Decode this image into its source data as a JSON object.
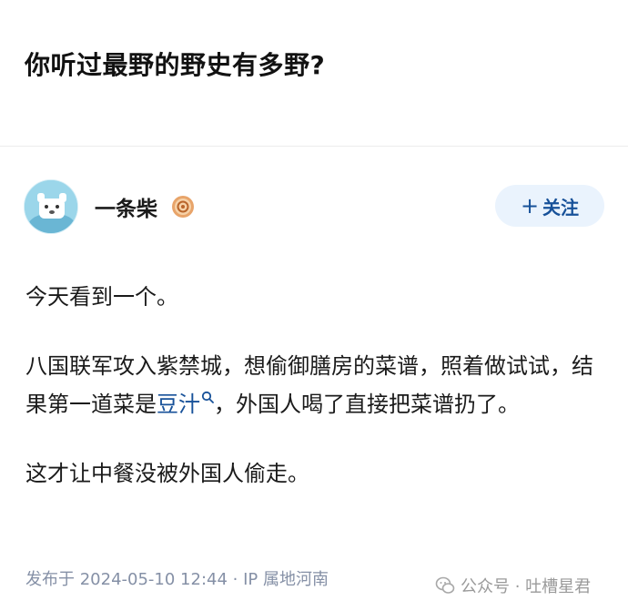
{
  "question": {
    "title": "你听过最野的野史有多野?"
  },
  "author": {
    "name": "一条柴",
    "follow_label": "关注",
    "follow_plus": "+"
  },
  "answer": {
    "para1": "今天看到一个。",
    "para2_before": "八国联军攻入紫禁城，想偷御膳房的菜谱，照着做试试，结果第一道菜是",
    "para2_link": "豆汁",
    "para2_after": "，外国人喝了直接把菜谱扔了。",
    "para3": "这才让中餐没被外国人偷走。"
  },
  "meta": {
    "published": "发布于 2024-05-10 12:44 · IP 属地河南"
  },
  "watermark": {
    "text": "公众号 · 吐槽星君"
  },
  "colors": {
    "link": "#175199",
    "follow_bg": "#eaf3fd",
    "meta": "#8590a6"
  },
  "icons": {
    "avatar": "avatar-cartoon",
    "badge": "badge-icon",
    "search": "search-icon",
    "watermark": "wechat-icon"
  }
}
